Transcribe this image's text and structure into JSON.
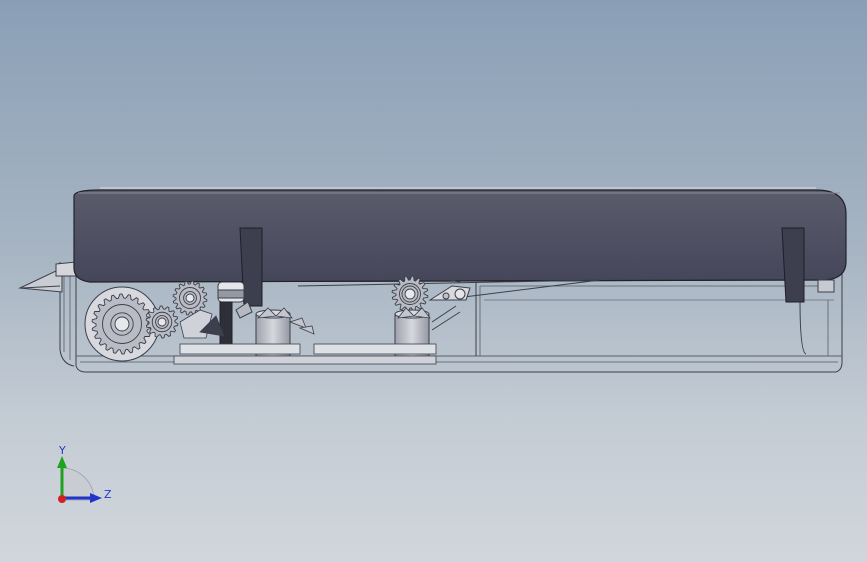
{
  "triad": {
    "y_label": "Y",
    "z_label": "Z",
    "colors": {
      "y": "#1fa21f",
      "z": "#2233cc",
      "x": "#d02020",
      "label": "#2a36c8"
    }
  },
  "colors": {
    "lid": "#4b4c5c",
    "housing_line": "#3b3f4a",
    "gear_fill": "#b9bcc4",
    "background_top": "#8a9fb6",
    "background_bottom": "#d1d6dc"
  }
}
